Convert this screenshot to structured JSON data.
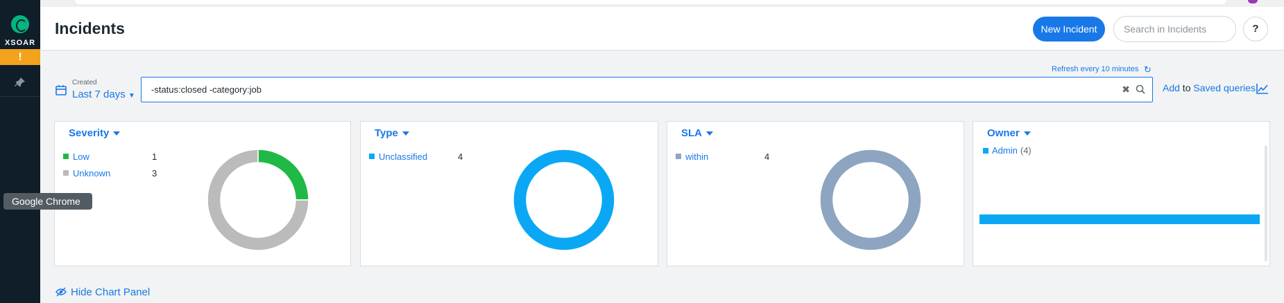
{
  "app": {
    "logo_text": "XSOAR",
    "alert_glyph": "!"
  },
  "header": {
    "title": "Incidents",
    "new_incident": "New Incident",
    "search_placeholder": "Search in Incidents",
    "help": "?"
  },
  "filters": {
    "refresh": "Refresh every 10 minutes",
    "created_label": "Created",
    "created_value": "Last 7 days",
    "query": "-status:closed -category:job",
    "add": "Add",
    "to": " to ",
    "saved_queries": "Saved queries"
  },
  "panels": {
    "severity": {
      "title": "Severity",
      "items": [
        {
          "label": "Low",
          "count": "1",
          "color": "#20b946"
        },
        {
          "label": "Unknown",
          "count": "3",
          "color": "#bbbbbb"
        }
      ]
    },
    "type": {
      "title": "Type",
      "items": [
        {
          "label": "Unclassified",
          "count": "4",
          "color": "#0aa8f4"
        }
      ]
    },
    "sla": {
      "title": "SLA",
      "items": [
        {
          "label": "within",
          "count": "4",
          "color": "#8da5c0"
        }
      ]
    },
    "owner": {
      "title": "Owner",
      "items": [
        {
          "label": "Admin",
          "count": "(4)",
          "color": "#0aa8f4"
        }
      ]
    }
  },
  "chart_data": [
    {
      "type": "pie",
      "title": "Severity",
      "categories": [
        "Low",
        "Unknown"
      ],
      "values": [
        1,
        3
      ]
    },
    {
      "type": "pie",
      "title": "Type",
      "categories": [
        "Unclassified"
      ],
      "values": [
        4
      ]
    },
    {
      "type": "pie",
      "title": "SLA",
      "categories": [
        "within"
      ],
      "values": [
        4
      ]
    },
    {
      "type": "bar",
      "title": "Owner",
      "categories": [
        "Admin"
      ],
      "values": [
        4
      ]
    }
  ],
  "tooltip": "Google Chrome",
  "footer": {
    "hide_chart_panel": "Hide Chart Panel"
  }
}
